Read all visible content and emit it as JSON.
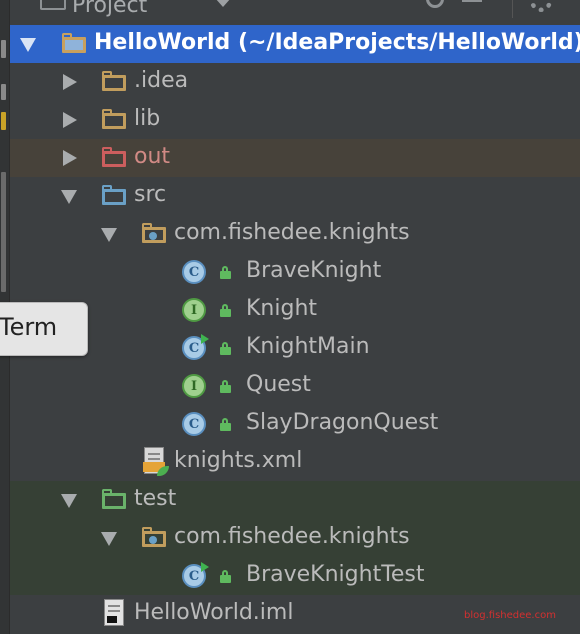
{
  "panel": {
    "title": "Project"
  },
  "tree": {
    "root": {
      "name": "HelloWorld",
      "path": "(~/IdeaProjects/HelloWorld)"
    },
    "idea": ".idea",
    "lib": "lib",
    "out": "out",
    "src": "src",
    "src_package": "com.fishedee.knights",
    "src_files": [
      {
        "name": "BraveKnight",
        "kind": "class",
        "badge": "C"
      },
      {
        "name": "Knight",
        "kind": "interface",
        "badge": "I"
      },
      {
        "name": "KnightMain",
        "kind": "class-main",
        "badge": "C"
      },
      {
        "name": "Quest",
        "kind": "interface",
        "badge": "I"
      },
      {
        "name": "SlayDragonQuest",
        "kind": "class",
        "badge": "C"
      }
    ],
    "xml_file": "knights.xml",
    "test": "test",
    "test_package": "com.fishedee.knights",
    "test_files": [
      {
        "name": "BraveKnightTest",
        "kind": "class-main",
        "badge": "C"
      }
    ],
    "iml_file": "HelloWorld.iml"
  },
  "tooltip": {
    "text": "Term"
  },
  "watermark": "blog.fishedee.com",
  "colors": {
    "selection": "#2f65ca",
    "background": "#3c3f41",
    "excluded_row": "#47423a",
    "test_row": "#364035"
  }
}
